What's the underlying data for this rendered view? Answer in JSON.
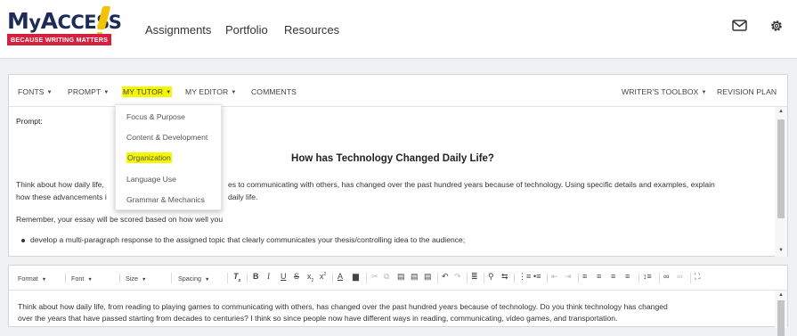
{
  "app": {
    "logo_text": "MyACCESS!",
    "logo_tagline": "BECAUSE WRITING MATTERS"
  },
  "nav": {
    "assignments": "Assignments",
    "portfolio": "Portfolio",
    "resources": "Resources"
  },
  "icons": {
    "mail": "mail-icon",
    "settings": "gear-icon"
  },
  "menubar": {
    "fonts": "FONTS",
    "prompt": "PROMPT",
    "my_tutor": "MY TUTOR",
    "my_editor": "MY EDITOR",
    "comments": "COMMENTS",
    "writers_toolbox": "WRITER'S TOOLBOX",
    "revision_plan": "REVISION PLAN"
  },
  "tutor_dropdown": {
    "items": [
      "Focus & Purpose",
      "Content & Development",
      "Organization",
      "Language Use",
      "Grammar & Mechanics"
    ],
    "selected": "Organization"
  },
  "prompt": {
    "label": "Prompt:",
    "title": "How has Technology Changed Daily Life?",
    "paragraph_1a": "Think about how daily life,",
    "paragraph_1b": "es to communicating with others, has changed over the past hundred years because of technology. Using specific details and examples, explain",
    "paragraph_1c": "how these advancements i",
    "paragraph_1d": "daily life.",
    "paragraph_2": "Remember, your essay will be scored based on how well you",
    "bullets": [
      "develop a multi-paragraph response to the assigned topic that clearly communicates your thesis/controlling idea to the audience;"
    ]
  },
  "editor": {
    "format": "Format",
    "font": "Font",
    "size": "Size",
    "spacing": "Spacing",
    "line_1": "Think about how daily life, from reading to playing games to communicating with others, has changed over the past hundred years because of technology. Do you think technology has changed",
    "line_2": "over the years that have passed starting from decades to centuries? I think so since people now have different ways in reading, communicating, video games, and transportation."
  },
  "colors": {
    "highlight": "#f4f700",
    "brand_red": "#d6213e",
    "brand_navy": "#1d2b57",
    "brand_yellow": "#f2c300"
  }
}
